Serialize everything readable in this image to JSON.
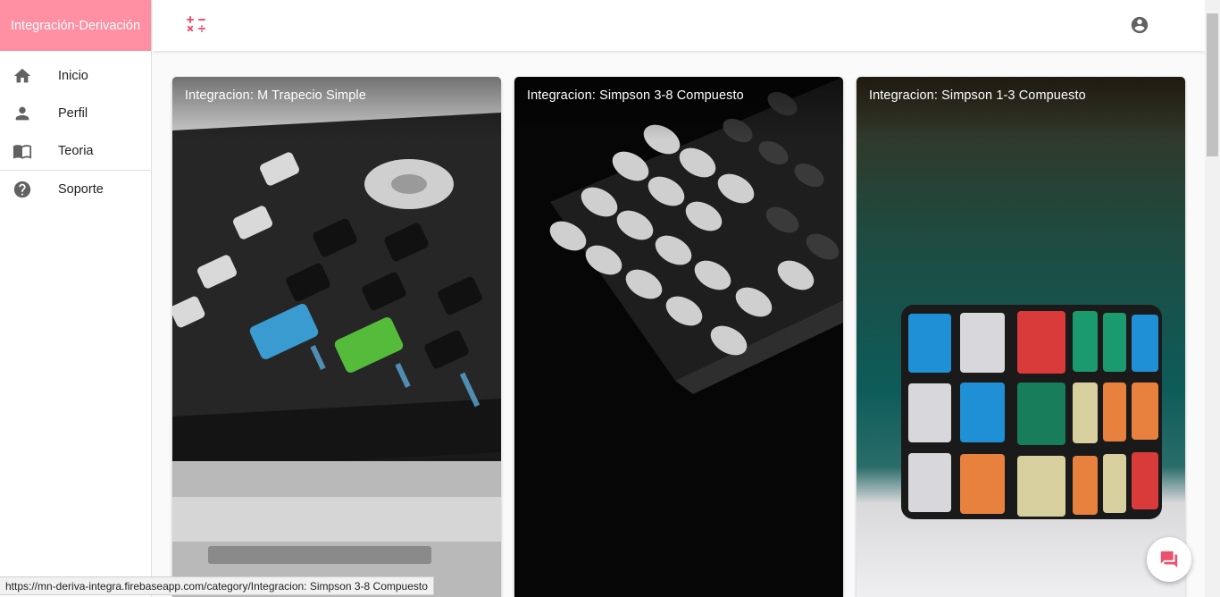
{
  "app": {
    "brand": "Integración-Derivación"
  },
  "sidebar": {
    "items": [
      {
        "label": "Inicio",
        "icon": "home-icon"
      },
      {
        "label": "Perfil",
        "icon": "person-icon"
      },
      {
        "label": "Teoria",
        "icon": "book-icon"
      },
      {
        "label": "Soporte",
        "icon": "help-icon"
      }
    ]
  },
  "topbar": {
    "logo_icon": "math-operators-icon",
    "account_icon": "account-circle-icon"
  },
  "cards": [
    {
      "title": "Integracion: M Trapecio Simple",
      "image": "graphing-calculator-photo"
    },
    {
      "title": "Integracion: Simpson 3-8 Compuesto",
      "image": "scientific-calculator-photo"
    },
    {
      "title": "Integracion: Simpson 1-3 Compuesto",
      "image": "rubiks-cube-photo"
    }
  ],
  "fab": {
    "icon": "chat-icon"
  },
  "status_bar": {
    "url": "https://mn-deriva-integra.firebaseapp.com/category/Integracion: Simpson 3-8 Compuesto"
  },
  "colors": {
    "brand": "#ff8fa3",
    "accent": "#f0506e"
  }
}
